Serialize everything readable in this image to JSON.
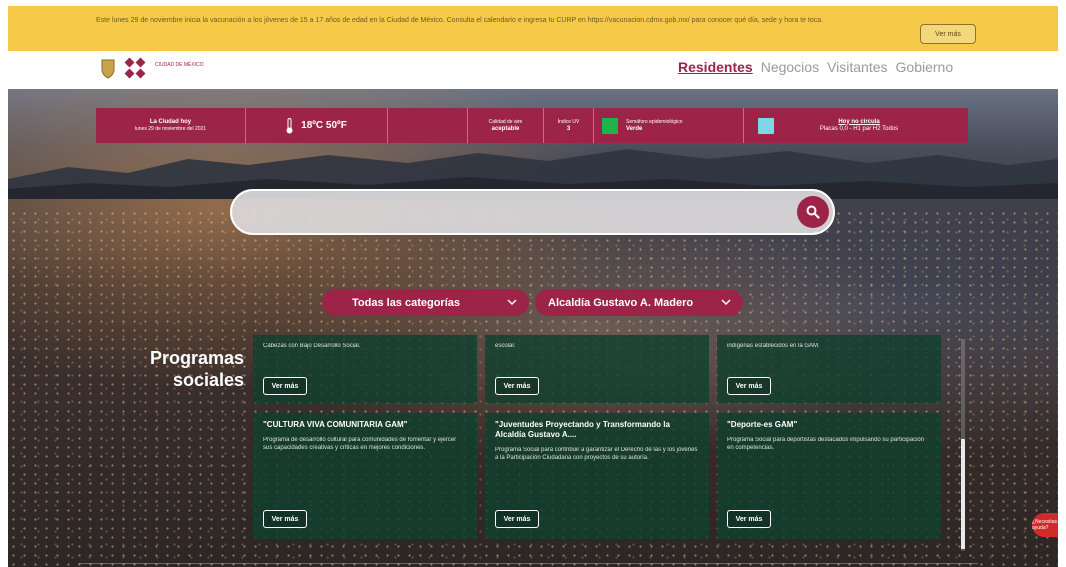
{
  "banner": {
    "text": "Este lunes 29 de noviembre inicia la vacunación a los jóvenes de 15 a 17 años de edad en la Ciudad de México. Consulta el calendario e ingresa tu CURP en https://vacunacion.cdmx.gob.mx/ para conocer qué día, sede y hora te toca.",
    "button_label": "Ver más"
  },
  "header": {
    "logo_text": "CIUDAD DE MÉXICO",
    "nav": [
      "Residentes",
      "Negocios",
      "Visitantes",
      "Gobierno"
    ],
    "active_nav": "Residentes"
  },
  "infobar": {
    "city_label": "La Ciudad hoy",
    "date": "lunes 29 de noviembre del 2021",
    "temperature": "18ºC 50ºF",
    "air_quality_label": "Calidad de aire",
    "air_quality_value": "aceptable",
    "uv_label": "Índice UV",
    "uv_value": "3",
    "semaforo_label": "Semáforo epidemiológico",
    "semaforo_value": "Verde",
    "traffic_link": "Hoy no circula",
    "traffic_text": "Placas 0,0 - H1 par H2 Todos",
    "colors": {
      "bar": "#9d2449",
      "semaforo": "#1fb34b",
      "traffic": "#7fd6e6"
    }
  },
  "search": {
    "placeholder": ""
  },
  "filters": {
    "category": "Todas las categorías",
    "alcaldia": "Alcaldía Gustavo A. Madero"
  },
  "programs": {
    "title_line1": "Programas",
    "title_line2": "sociales",
    "more_label": "Ver más",
    "row1": [
      {
        "desc": "Cabezas con Bajo Desarrollo Social."
      },
      {
        "desc": "escolar."
      },
      {
        "desc": "indígenas establecidos en la GAM."
      }
    ],
    "row2": [
      {
        "title": "\"CULTURA VIVA COMUNITARIA GAM\"",
        "desc": "Programa de desarrollo cultural para comunidades de fomentar y ejercer sus capacidades creativas y críticas en mejores condiciones."
      },
      {
        "title": "\"Juventudes Proyectando y Transformando la Alcaldía Gustavo A....",
        "desc": "Programa Social para contribuir a garantizar el Derecho de las y los jóvenes a la Participación Ciudadana con proyectos de su autoría."
      },
      {
        "title": "\"Deporte-es GAM\"",
        "desc": "Programa Social para deportistas destacados impulsando su participación en competencias."
      }
    ]
  },
  "chat": {
    "label": "¿Necesitas ayuda?"
  }
}
